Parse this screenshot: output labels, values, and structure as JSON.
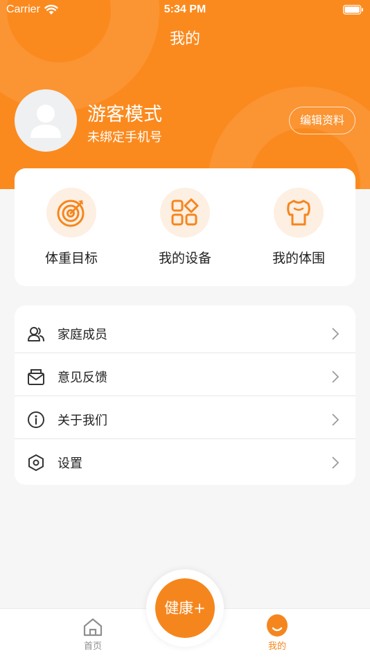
{
  "status_bar": {
    "carrier": "Carrier",
    "time": "5:34 PM"
  },
  "header": {
    "title": "我的"
  },
  "profile": {
    "name": "游客模式",
    "phone_status": "未绑定手机号",
    "edit_label": "编辑资料"
  },
  "quick_actions": [
    {
      "label": "体重目标",
      "icon": "target-icon"
    },
    {
      "label": "我的设备",
      "icon": "devices-icon"
    },
    {
      "label": "我的体围",
      "icon": "body-measure-icon"
    }
  ],
  "menu": [
    {
      "label": "家庭成员",
      "icon": "family-members-icon"
    },
    {
      "label": "意见反馈",
      "icon": "feedback-mail-icon"
    },
    {
      "label": "关于我们",
      "icon": "info-icon"
    },
    {
      "label": "设置",
      "icon": "settings-hexagon-icon"
    }
  ],
  "tab_bar": {
    "home_label": "首页",
    "health_label": "健康+",
    "mine_label": "我的"
  },
  "colors": {
    "accent": "#fb8a1e",
    "icon_bg": "#fdefe2",
    "background": "#f6f6f6"
  }
}
